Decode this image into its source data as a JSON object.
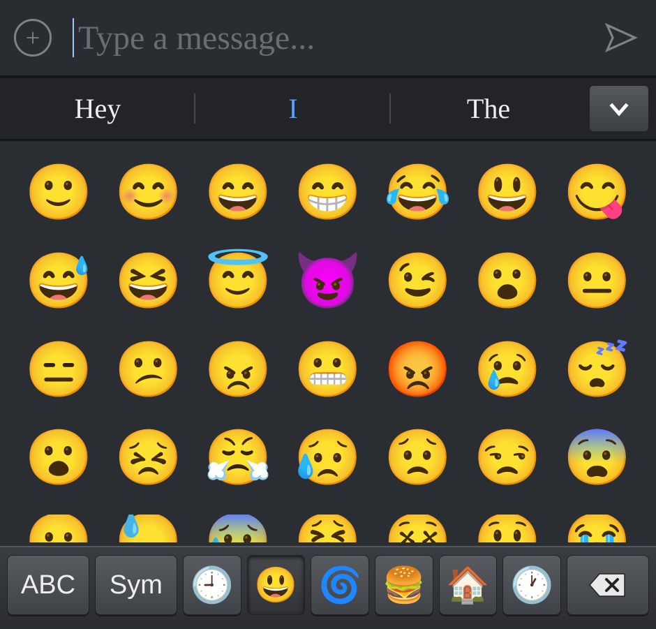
{
  "input": {
    "placeholder": "Type a message...",
    "value": ""
  },
  "suggestions": [
    "Hey",
    "I",
    "The"
  ],
  "selected_suggestion_index": 1,
  "emoji_rows": [
    [
      "🙂",
      "😊",
      "😄",
      "😁",
      "😂",
      "😃",
      "😋"
    ],
    [
      "😅",
      "😆",
      "😇",
      "😈",
      "😉",
      "😮",
      "😐"
    ],
    [
      "😑",
      "😕",
      "😠",
      "😬",
      "😡",
      "😢",
      "😴"
    ],
    [
      "😮",
      "😣",
      "😤",
      "😥",
      "😟",
      "😒",
      "😨"
    ],
    [
      "😶",
      "😓",
      "😰",
      "😫",
      "😵",
      "😲",
      "😭"
    ]
  ],
  "bottom_keys": {
    "abc": "ABC",
    "sym": "Sym",
    "categories": [
      "🕘",
      "😃",
      "🌀",
      "🍔",
      "🏠",
      "🕐"
    ],
    "selected_category_index": 1
  }
}
